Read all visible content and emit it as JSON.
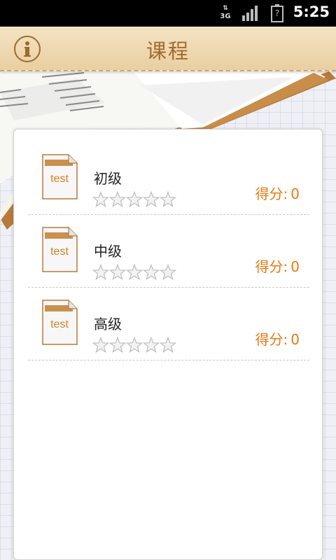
{
  "status_bar": {
    "network_type": "3G",
    "battery_text": "?",
    "time": "5:25"
  },
  "header": {
    "title": "课程",
    "info_icon": "info-icon"
  },
  "courses": [
    {
      "name": "初级",
      "icon_label": "test",
      "stars_filled": 0,
      "stars_total": 5,
      "score_label": "得分:",
      "score_value": "0"
    },
    {
      "name": "中级",
      "icon_label": "test",
      "stars_filled": 0,
      "stars_total": 5,
      "score_label": "得分:",
      "score_value": "0"
    },
    {
      "name": "高级",
      "icon_label": "test",
      "stars_filled": 0,
      "stars_total": 5,
      "score_label": "得分:",
      "score_value": "0"
    }
  ],
  "colors": {
    "accent_orange": "#e57a12",
    "header_brown": "#a36a2b"
  }
}
